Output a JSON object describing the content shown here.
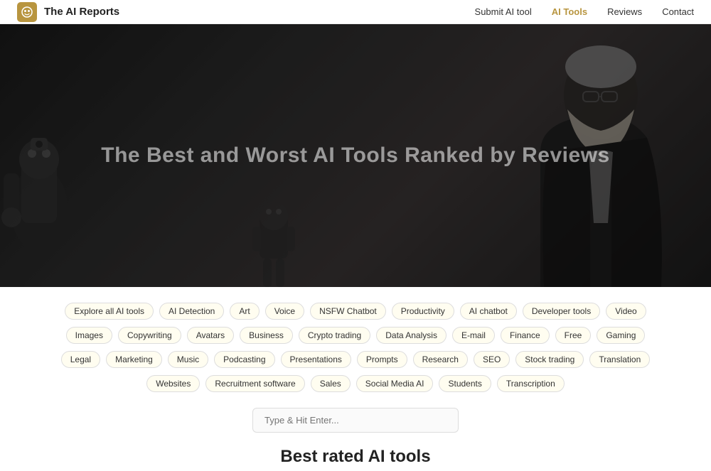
{
  "header": {
    "logo_icon": "🤖",
    "logo_text": "The AI Reports",
    "nav": [
      {
        "label": "Submit AI tool",
        "active": false
      },
      {
        "label": "AI Tools",
        "active": true
      },
      {
        "label": "Reviews",
        "active": false
      },
      {
        "label": "Contact",
        "active": false
      }
    ]
  },
  "hero": {
    "title": "The Best and Worst AI Tools Ranked by Reviews"
  },
  "tags": {
    "rows": [
      [
        "Explore all AI tools",
        "AI Detection",
        "Art",
        "Voice",
        "NSFW Chatbot",
        "Productivity",
        "AI chatbot",
        "Developer tools",
        "Video"
      ],
      [
        "Images",
        "Copywriting",
        "Avatars",
        "Business",
        "Crypto trading",
        "Data Analysis",
        "E-mail",
        "Finance",
        "Free",
        "Gaming"
      ],
      [
        "Legal",
        "Marketing",
        "Music",
        "Podcasting",
        "Presentations",
        "Prompts",
        "Research",
        "SEO",
        "Stock trading",
        "Translation"
      ],
      [
        "Websites",
        "Recruitment software",
        "Sales",
        "Social Media AI",
        "Students",
        "Transcription"
      ]
    ]
  },
  "search": {
    "placeholder": "Type & Hit Enter..."
  },
  "best_rated": {
    "title": "Best rated AI tools"
  }
}
